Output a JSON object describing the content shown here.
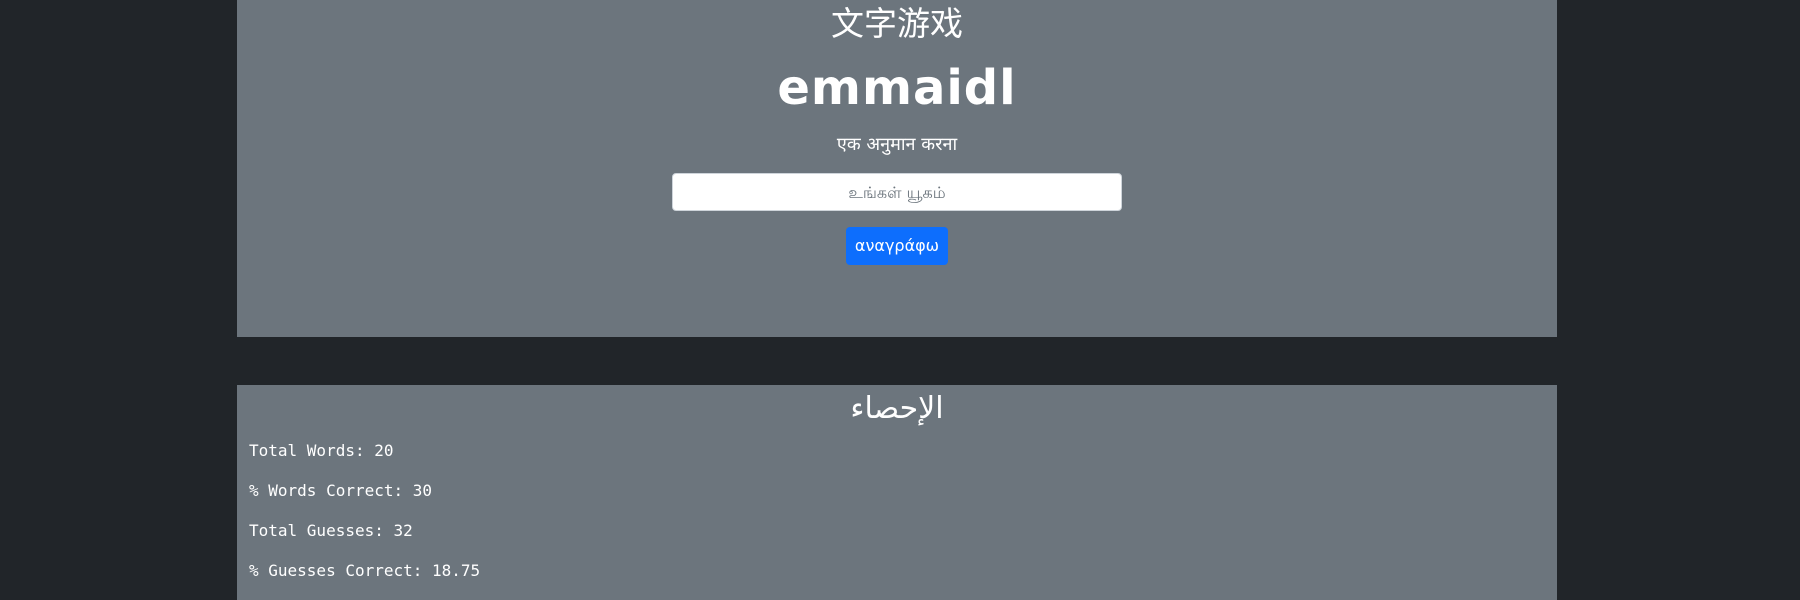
{
  "game": {
    "title": "文字游戏",
    "scrambled_word": "emmaidl",
    "prompt": "एक अनुमान करना",
    "input": {
      "placeholder": "உங்கள் யூகம்",
      "value": ""
    },
    "submit_label": "αναγράφω"
  },
  "stats": {
    "title": "الإحصاء",
    "lines": [
      "Total Words: 20",
      "% Words Correct: 30",
      "Total Guesses: 32",
      "% Guesses Correct: 18.75"
    ]
  },
  "colors": {
    "page_background": "#212529",
    "panel_background": "#6c757d",
    "button_primary": "#0d6efd",
    "text": "#ffffff"
  }
}
